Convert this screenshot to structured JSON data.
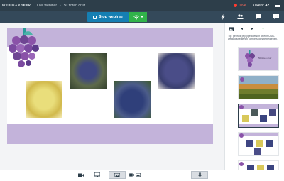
{
  "brand": "WEBINARGEEK",
  "breadcrumb": [
    "Live webinar",
    "50 tinten druif"
  ],
  "status": {
    "live_label": "Live",
    "viewers_label": "Kijkers:",
    "viewers_count": "42"
  },
  "controls": {
    "stop_label": "Stop webinar"
  },
  "sidebar": {
    "tip": "Tip: gebruik je pijltjestoetsen of een USB-afstandsbediening om je slides te bedienen.",
    "thumb_caption": "50 tinten druif",
    "selected_index": 2
  },
  "bottom_tools": [
    "camera-icon",
    "screen-share-icon",
    "slide-icon",
    "camera-slide-icon",
    "microphone-icon"
  ],
  "colors": {
    "topbar": "#2d3e4a",
    "controlbar": "#34495a",
    "stop_button": "#157fb3",
    "connection_button": "#31b34a",
    "slide_band": "#c3b3da",
    "live": "#ff3b30"
  }
}
